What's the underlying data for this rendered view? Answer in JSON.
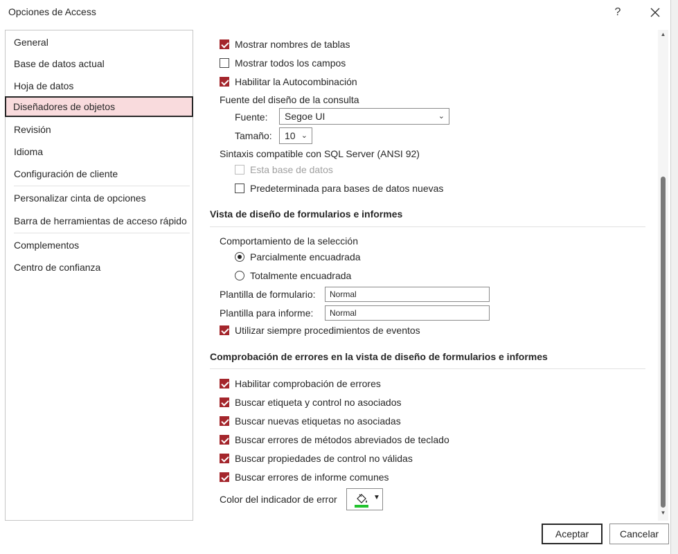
{
  "window": {
    "title": "Opciones de Access",
    "help": "?"
  },
  "nav": {
    "items": [
      "General",
      "Base de datos actual",
      "Hoja de datos",
      "Diseñadores de objetos",
      "Revisión",
      "Idioma",
      "Configuración de cliente",
      "Personalizar cinta de opciones",
      "Barra de herramientas de acceso rápido",
      "Complementos",
      "Centro de confianza"
    ],
    "active_index": 3
  },
  "query_design": {
    "show_table_names": "Mostrar nombres de tablas",
    "show_all_fields": "Mostrar todos los campos",
    "autojoin": "Habilitar la Autocombinación",
    "font_group_label": "Fuente del diseño de la consulta",
    "font_label": "Fuente:",
    "font_value": "Segoe UI",
    "size_label": "Tamaño:",
    "size_value": "10",
    "sql_group_label": "Sintaxis compatible con SQL Server (ANSI 92)",
    "this_db": "Esta base de datos",
    "default_new": "Predeterminada para bases de datos nuevas"
  },
  "form_design": {
    "title": "Vista de diseño de formularios e informes",
    "selection_label": "Comportamiento de la selección",
    "partial": "Parcialmente encuadrada",
    "full": "Totalmente encuadrada",
    "form_template_label": "Plantilla de formulario:",
    "form_template_value": "Normal",
    "report_template_label": "Plantilla para informe:",
    "report_template_value": "Normal",
    "always_events": "Utilizar siempre procedimientos de eventos"
  },
  "error_check": {
    "title": "Comprobación de errores en la vista de diseño de formularios e informes",
    "enable": "Habilitar comprobación de errores",
    "unassoc_label_control": "Buscar etiqueta y control no asociados",
    "new_unassoc_labels": "Buscar nuevas etiquetas no asociadas",
    "shortcut_errors": "Buscar errores de métodos abreviados de teclado",
    "invalid_props": "Buscar propiedades de control no válidas",
    "report_errors": "Buscar errores de informe comunes",
    "indicator_color_label": "Color del indicador de error",
    "indicator_color": "#22c32e"
  },
  "buttons": {
    "ok": "Aceptar",
    "cancel": "Cancelar"
  },
  "colors": {
    "accent": "#a4262c",
    "nav_active_bg": "#f9dbdd"
  }
}
